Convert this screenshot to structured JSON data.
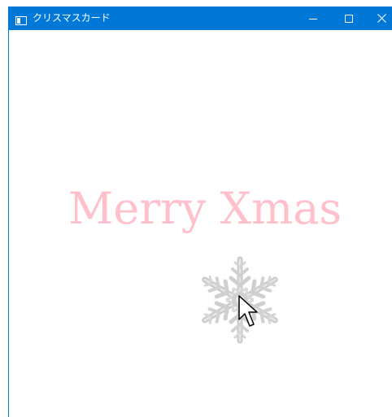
{
  "window": {
    "title": "クリスマスカード",
    "titlebar_color": "#0078d7",
    "icons": {
      "app": "window-app-icon",
      "minimize": "minimize-icon",
      "maximize": "maximize-icon",
      "close": "close-icon"
    }
  },
  "card": {
    "greeting": "Merry Xmas",
    "greeting_color": "#ffc0cb",
    "decoration": "snowflake-icon",
    "pointer": "mouse-cursor-icon"
  }
}
